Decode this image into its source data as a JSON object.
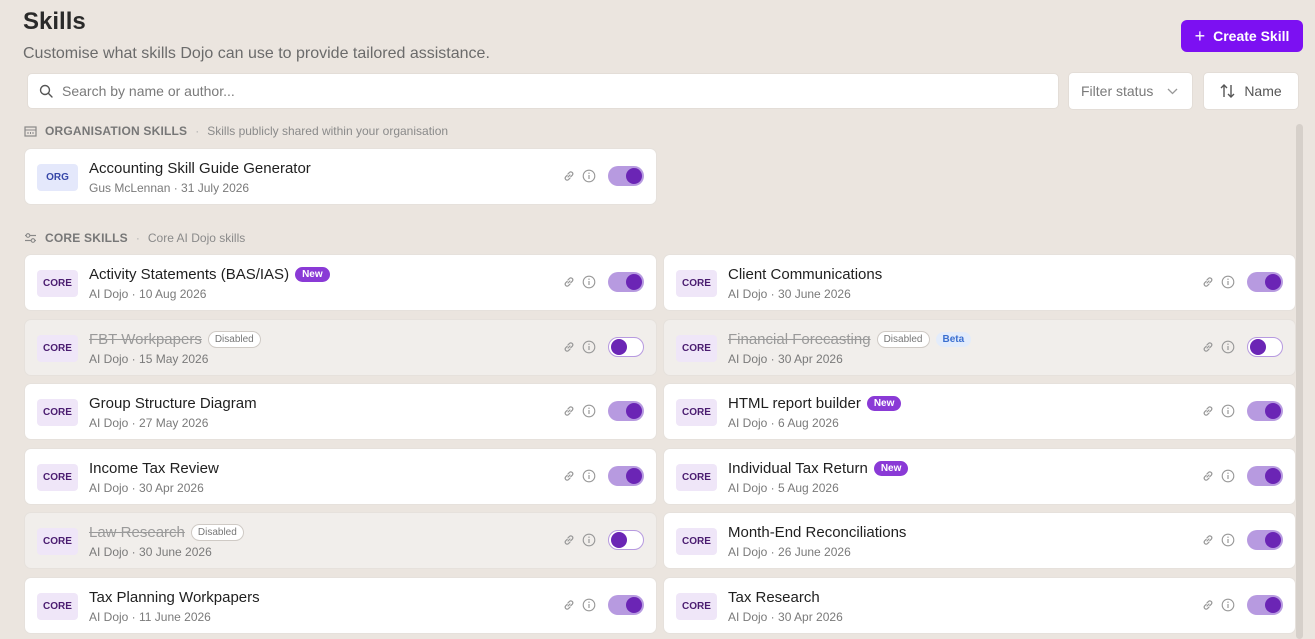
{
  "header": {
    "title": "Skills",
    "subtitle": "Customise what skills Dojo can use to provide tailored assistance.",
    "create_label": "Create Skill"
  },
  "search": {
    "placeholder": "Search by name or author..."
  },
  "filter": {
    "label": "Filter status"
  },
  "sort": {
    "label": "Name"
  },
  "org_section": {
    "title": "ORGANISATION SKILLS",
    "dot": "·",
    "description": "Skills publicly shared within your organisation"
  },
  "core_section": {
    "title": "CORE SKILLS",
    "dot": "·",
    "description": "Core AI Dojo skills"
  },
  "org_skills": [
    {
      "kind": "ORG",
      "name": "Accounting Skill Guide Generator",
      "meta": "Gus McLennan · 31 July 2026",
      "enabled": true
    }
  ],
  "core_skills": [
    {
      "kind": "CORE",
      "name": "Activity Statements (BAS/IAS)",
      "meta": "AI Dojo · 10 Aug 2026",
      "enabled": true,
      "tags": [
        "New"
      ]
    },
    {
      "kind": "CORE",
      "name": "Client Communications",
      "meta": "AI Dojo · 30 June 2026",
      "enabled": true,
      "tags": []
    },
    {
      "kind": "CORE",
      "name": "FBT Workpapers",
      "meta": "AI Dojo · 15 May 2026",
      "enabled": false,
      "tags": [
        "Disabled"
      ]
    },
    {
      "kind": "CORE",
      "name": "Financial Forecasting",
      "meta": "AI Dojo · 30 Apr 2026",
      "enabled": false,
      "tags": [
        "Disabled",
        "Beta"
      ]
    },
    {
      "kind": "CORE",
      "name": "Group Structure Diagram",
      "meta": "AI Dojo · 27 May 2026",
      "enabled": true,
      "tags": []
    },
    {
      "kind": "CORE",
      "name": "HTML report builder",
      "meta": "AI Dojo · 6 Aug 2026",
      "enabled": true,
      "tags": [
        "New"
      ]
    },
    {
      "kind": "CORE",
      "name": "Income Tax Review",
      "meta": "AI Dojo · 30 Apr 2026",
      "enabled": true,
      "tags": []
    },
    {
      "kind": "CORE",
      "name": "Individual Tax Return",
      "meta": "AI Dojo · 5 Aug 2026",
      "enabled": true,
      "tags": [
        "New"
      ]
    },
    {
      "kind": "CORE",
      "name": "Law Research",
      "meta": "AI Dojo · 30 June 2026",
      "enabled": false,
      "tags": [
        "Disabled"
      ]
    },
    {
      "kind": "CORE",
      "name": "Month-End Reconciliations",
      "meta": "AI Dojo · 26 June 2026",
      "enabled": true,
      "tags": []
    },
    {
      "kind": "CORE",
      "name": "Tax Planning Workpapers",
      "meta": "AI Dojo · 11 June 2026",
      "enabled": true,
      "tags": []
    },
    {
      "kind": "CORE",
      "name": "Tax Research",
      "meta": "AI Dojo · 30 Apr 2026",
      "enabled": true,
      "tags": []
    }
  ],
  "colors": {
    "accent": "#7c10f2",
    "toggle_on": "#b79ae0",
    "knob": "#6b25b5",
    "tag_new": "#8a3ad6"
  }
}
